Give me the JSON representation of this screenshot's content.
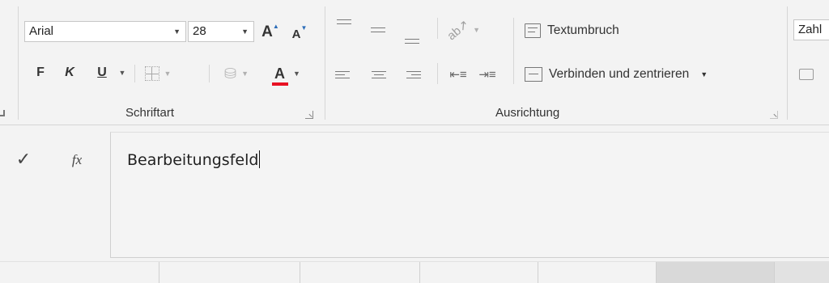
{
  "ribbon": {
    "font_name": "Arial",
    "font_size": "28",
    "bold_label": "F",
    "italic_label": "K",
    "underline_label": "U",
    "grow_font_label": "A",
    "shrink_font_label": "A",
    "font_color_label": "A",
    "font_color_accent": "#e81123",
    "group_font_label": "Schriftart",
    "wrap_text_label": "Textumbruch",
    "merge_center_label": "Verbinden und zentrieren",
    "group_alignment_label": "Ausrichtung",
    "number_format_partial": "Zahl"
  },
  "formula_bar": {
    "enter_symbol": "✓",
    "fx_label": "fx",
    "content": "Bearbeitungsfeld"
  }
}
